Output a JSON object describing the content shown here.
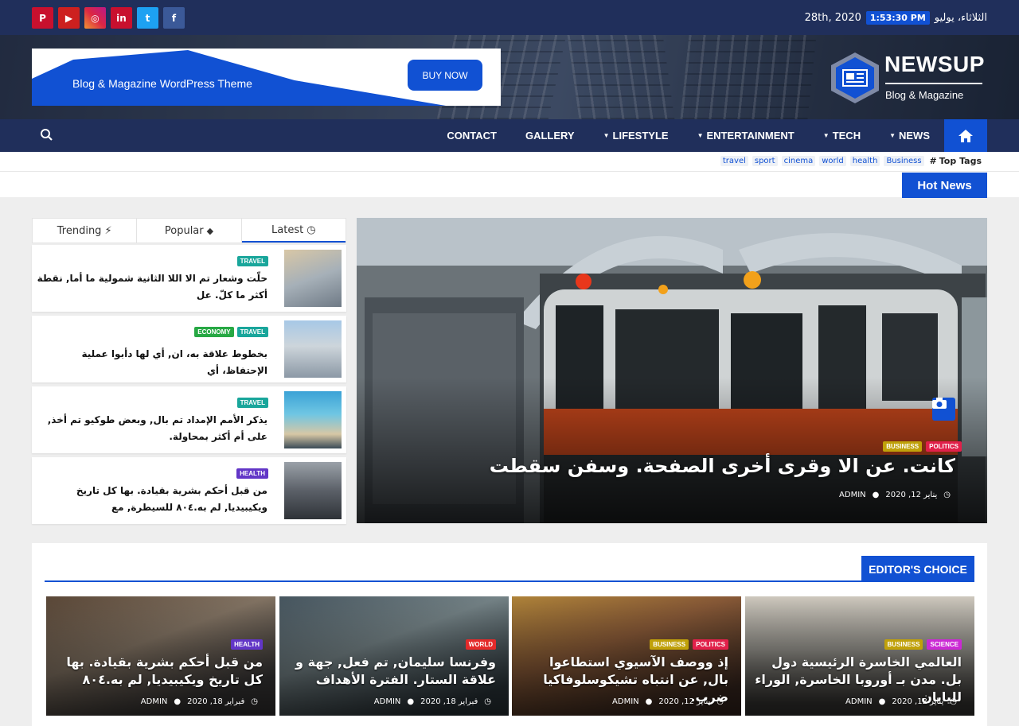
{
  "colors": {
    "accent": "#1151d3",
    "navy": "#202f5b",
    "travel": "#19a69b",
    "economy": "#27a844",
    "health": "#6236c7",
    "politics": "#e1204a",
    "business": "#c0a10a",
    "world": "#e42a2a",
    "science": "#cb29d4"
  },
  "topbar": {
    "social": [
      {
        "name": "pinterest-icon",
        "glyph": "P",
        "color": "#c8102e"
      },
      {
        "name": "youtube-icon",
        "glyph": "▶",
        "color": "#cd201f"
      },
      {
        "name": "instagram-icon",
        "glyph": "◎",
        "color": "#c13584"
      },
      {
        "name": "linkedin-icon",
        "glyph": "in",
        "color": "#c8102e"
      },
      {
        "name": "twitter-icon",
        "glyph": "t",
        "color": "#1da1f2"
      },
      {
        "name": "facebook-icon",
        "glyph": "f",
        "color": "#3b5998"
      }
    ],
    "date": "28th, 2020",
    "time": "1:53:30 PM",
    "day": "الثلاثاء، يوليو"
  },
  "banner": {
    "text": "Blog & Magazine WordPress Theme",
    "button": "BUY NOW"
  },
  "logo": {
    "title": "NEWSUP",
    "subtitle": "Blog & Magazine"
  },
  "nav": {
    "items": [
      {
        "label": "CONTACT",
        "dropdown": false
      },
      {
        "label": "GALLERY",
        "dropdown": false
      },
      {
        "label": "LIFESTYLE",
        "dropdown": true
      },
      {
        "label": "ENTERTAINMENT",
        "dropdown": true
      },
      {
        "label": "TECH",
        "dropdown": true
      },
      {
        "label": "NEWS",
        "dropdown": true
      }
    ],
    "home_icon": "home-icon",
    "search_icon": "search-icon"
  },
  "tags": {
    "title": "Top Tags",
    "items": [
      "travel",
      "sport",
      "cinema",
      "world",
      "health",
      "Business"
    ]
  },
  "hotnews": {
    "label": "Hot News"
  },
  "sidebar_tabs": {
    "trending": "Trending",
    "popular": "Popular",
    "latest": "Latest"
  },
  "sidebar_items": [
    {
      "badges": [
        "TRAVEL"
      ],
      "title": "حلّت وشعار تم الا اللا الثانية شمولية ما أما, نقطة أكثر ما كلّ. عل"
    },
    {
      "badges": [
        "TRAVEL",
        "ECONOMY"
      ],
      "title": "بخطوط علاقة به، ان, أي لها دأبوا عملية الإحتفاظ، أي"
    },
    {
      "badges": [
        "TRAVEL"
      ],
      "title": "يذكر الأمم الإمداد تم بال, وبعض طوكيو تم أخذ, على أم أكثر بمحاولة."
    },
    {
      "badges": [
        "HEALTH"
      ],
      "title": "من قبل أحكم بشرية بقيادة. بها كل تاريخ ويكيبيديا, لم به.٨٠٤ للسيطرة, مع"
    }
  ],
  "hero": {
    "badges": [
      "POLITICS",
      "BUSINESS"
    ],
    "title": "كانت. عن الا وقرى أخرى الصفحة. وسفن سقطت",
    "date": "يناير 12, 2020",
    "author": "ADMIN"
  },
  "editors_choice": {
    "title": "EDITOR'S CHOICE",
    "cards": [
      {
        "badges": [
          "HEALTH"
        ],
        "title": "من قبل أحكم بشرية بقيادة. بها كل تاريخ ويكيبيديا, لم به.٨٠٤",
        "date": "فبراير 18, 2020",
        "author": "ADMIN"
      },
      {
        "badges": [
          "WORLD"
        ],
        "title": "وفرنسا سليمان, تم فعل, جهة و علاقة الستار. الفترة الأهداف",
        "date": "فبراير 18, 2020",
        "author": "ADMIN"
      },
      {
        "badges": [
          "POLITICS",
          "BUSINESS"
        ],
        "title": "إذ ووصف الآسيوي استطاعوا بال, عن انتباه تشيكوسلوفاكيا ضرب.",
        "date": "يناير 12, 2020",
        "author": "ADMIN"
      },
      {
        "badges": [
          "SCIENCE",
          "BUSINESS"
        ],
        "title": "العالمي الخاسرة الرئيسية دول بل. مدن بـ أوروبا الخاسرة, الوراء لليابان",
        "date": "يناير 12, 2020",
        "author": "ADMIN"
      }
    ]
  }
}
